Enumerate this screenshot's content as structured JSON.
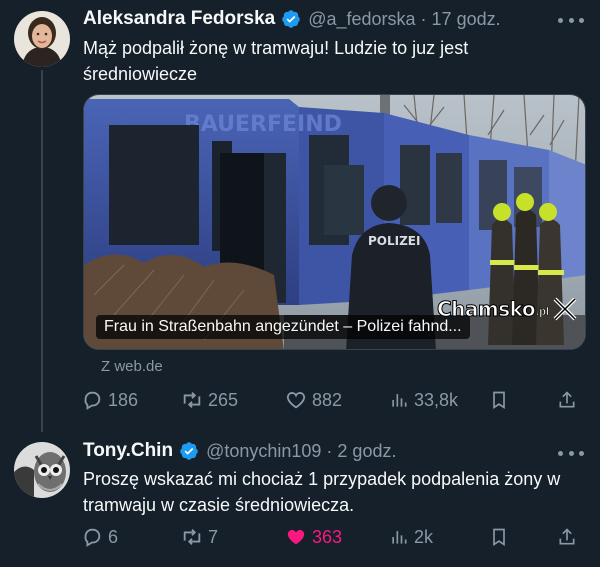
{
  "tweets": [
    {
      "author_name": "Aleksandra Fedorska",
      "handle": "@a_fedorska",
      "separator": "·",
      "time": "17 godz.",
      "text": "Mąż podpalił żonę w tramwaju! Ludzie to juz jest średniowiecze",
      "card": {
        "caption": "Frau in Straßenbahn angezündet – Polizei fahnd...",
        "source": "Z web.de",
        "tram_lettering": "BAUERFEIND",
        "police_lettering": "POLIZEI",
        "watermark": "Chamsko",
        "watermark_suffix": ".pl"
      },
      "stats": {
        "replies": "186",
        "reposts": "265",
        "likes": "882",
        "views": "33,8k"
      }
    },
    {
      "author_name": "Tony.Chin",
      "handle": "@tonychin109",
      "separator": "·",
      "time": "2 godz.",
      "text": "Proszę wskazać mi chociaż 1 przypadek podpalenia żony w tramwaju w czasie średniowiecza.",
      "stats": {
        "replies": "6",
        "reposts": "7",
        "likes": "363",
        "views": "2k"
      },
      "liked": true
    }
  ],
  "colors": {
    "background": "#15202b",
    "verified": "#1d9bf0",
    "like_active": "#f91880",
    "muted": "#8b98a5"
  },
  "icons": [
    "verified-badge-icon",
    "more-icon",
    "reply-icon",
    "repost-icon",
    "like-icon",
    "views-icon",
    "bookmark-icon",
    "share-icon"
  ]
}
